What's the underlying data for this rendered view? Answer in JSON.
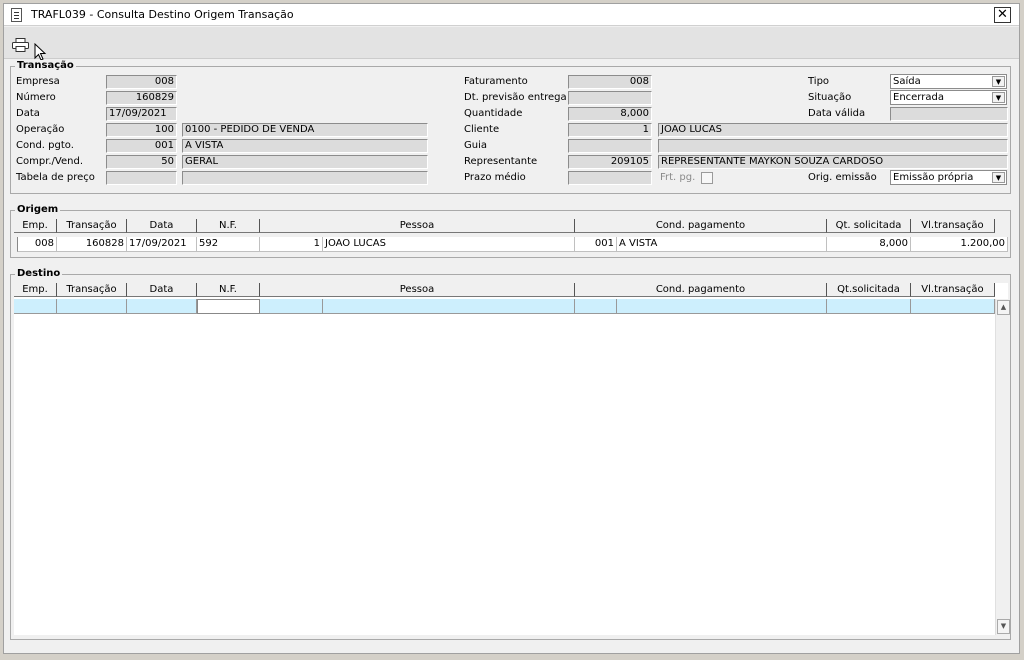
{
  "window": {
    "title": "TRAFL039 - Consulta Destino Origem Transação",
    "close_label": "✕"
  },
  "transacao": {
    "title": "Transação",
    "empresa": {
      "label": "Empresa",
      "value": "008"
    },
    "numero": {
      "label": "Número",
      "value": "160829"
    },
    "data": {
      "label": "Data",
      "value": "17/09/2021"
    },
    "operacao": {
      "label": "Operação",
      "code": "100",
      "desc": "0100 - PEDIDO DE VENDA"
    },
    "cond_pgto": {
      "label": "Cond. pgto.",
      "code": "001",
      "desc": "A VISTA"
    },
    "compr_vend": {
      "label": "Compr./Vend.",
      "code": "50",
      "desc": "GERAL"
    },
    "tabela_preco": {
      "label": "Tabela de preço",
      "code": "",
      "desc": ""
    },
    "faturamento": {
      "label": "Faturamento",
      "value": "008"
    },
    "dt_previsao": {
      "label": "Dt. previsão entrega",
      "value": ""
    },
    "quantidade": {
      "label": "Quantidade",
      "value": "8,000"
    },
    "cliente": {
      "label": "Cliente",
      "code": "1",
      "desc": "JOAO LUCAS"
    },
    "guia": {
      "label": "Guia",
      "code": "",
      "desc": ""
    },
    "representante": {
      "label": "Representante",
      "code": "209105",
      "desc": "REPRESENTANTE MAYKON SOUZA CARDOSO"
    },
    "prazo_medio": {
      "label": "Prazo médio",
      "value": ""
    },
    "frt_pg": {
      "label": "Frt. pg."
    },
    "tipo": {
      "label": "Tipo",
      "value": "Saída"
    },
    "situacao": {
      "label": "Situação",
      "value": "Encerrada"
    },
    "data_valida": {
      "label": "Data válida",
      "value": ""
    },
    "orig_emissao": {
      "label": "Orig. emissão",
      "value": "Emissão própria"
    }
  },
  "origem": {
    "title": "Origem",
    "headers": [
      "Emp.",
      "Transação",
      "Data",
      "N.F.",
      "Pessoa",
      "Cond. pagamento",
      "Qt. solicitada",
      "Vl.transação"
    ],
    "row": {
      "emp": "008",
      "transacao": "160828",
      "data": "17/09/2021",
      "nf": "592",
      "pessoa_code": "1",
      "pessoa": "JOAO LUCAS",
      "cond_code": "001",
      "cond": "A VISTA",
      "qt": "8,000",
      "vl": "1.200,00"
    }
  },
  "destino": {
    "title": "Destino",
    "headers": [
      "Emp.",
      "Transação",
      "Data",
      "N.F.",
      "Pessoa",
      "Cond. pagamento",
      "Qt.solicitada",
      "Vl.transação"
    ]
  },
  "icons": {
    "title": "document-icon",
    "print": "printer-icon",
    "cursor": "mouse-pointer-icon",
    "dropdown": "chevron-down-icon"
  }
}
